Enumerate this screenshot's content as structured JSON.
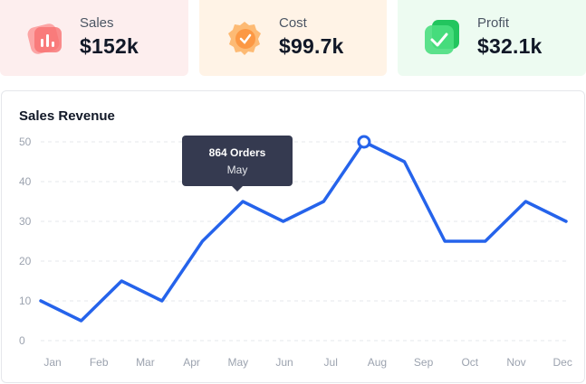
{
  "stats": [
    {
      "label": "Sales",
      "value": "$152k",
      "icon": "bar-chart-icon",
      "color": "#f87171"
    },
    {
      "label": "Cost",
      "value": "$99.7k",
      "icon": "badge-icon",
      "color": "#fb923c"
    },
    {
      "label": "Profit",
      "value": "$32.1k",
      "icon": "check-icon",
      "color": "#22c55e"
    }
  ],
  "chart_data": {
    "type": "line",
    "title": "Sales Revenue",
    "categories": [
      "Jan",
      "Feb",
      "Mar",
      "Apr",
      "May",
      "Jun",
      "Jul",
      "Aug",
      "Sep",
      "Oct",
      "Nov",
      "Dec"
    ],
    "x": [
      "Jan",
      "",
      "Feb",
      "",
      "Mar",
      "",
      "Apr",
      "",
      "May",
      "",
      "Jun",
      "",
      "Jul",
      "",
      "Aug",
      "",
      "Sep",
      "",
      "Oct",
      "",
      "Nov",
      "",
      "Dec",
      ""
    ],
    "values": [
      10,
      5,
      15,
      10,
      25,
      35,
      30,
      35,
      50,
      45,
      25,
      25,
      35,
      30
    ],
    "y_ticks": [
      0,
      10,
      20,
      30,
      40,
      50
    ],
    "ylim": [
      0,
      50
    ],
    "line_color": "#2563eb",
    "grid": true,
    "tooltip": {
      "title": "864 Orders",
      "subtitle": "May"
    }
  }
}
